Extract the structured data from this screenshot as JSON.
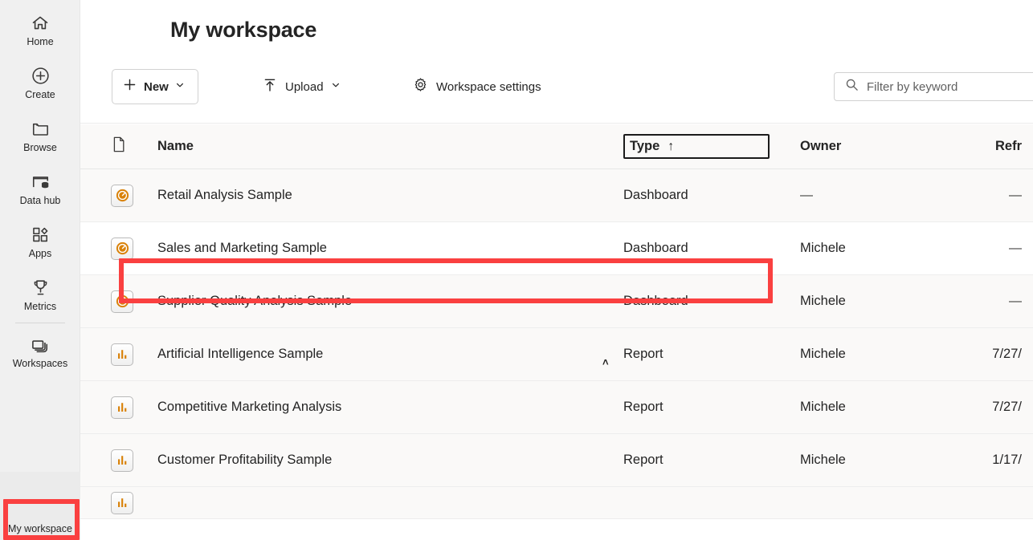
{
  "sidebar": {
    "items": [
      {
        "label": "Home",
        "icon": "home-icon"
      },
      {
        "label": "Create",
        "icon": "plus-circle-icon"
      },
      {
        "label": "Browse",
        "icon": "folder-icon"
      },
      {
        "label": "Data hub",
        "icon": "data-hub-icon"
      },
      {
        "label": "Apps",
        "icon": "apps-icon"
      },
      {
        "label": "Metrics",
        "icon": "trophy-icon"
      },
      {
        "label": "Workspaces",
        "icon": "workspaces-icon"
      }
    ],
    "active_workspace": {
      "label": "My workspace",
      "accent_color": "#0f6e64"
    }
  },
  "header": {
    "title": "My workspace"
  },
  "toolbar": {
    "new_label": "New",
    "new_icon": "plus-icon",
    "new_chevron": "chevron-down-icon",
    "upload_label": "Upload",
    "upload_icon": "upload-arrow-icon",
    "upload_chevron": "chevron-down-icon",
    "settings_label": "Workspace settings",
    "settings_icon": "gear-icon"
  },
  "search": {
    "placeholder": "Filter by keyword",
    "value": "",
    "icon": "search-icon"
  },
  "table": {
    "columns": {
      "icon": "document-icon",
      "name": "Name",
      "type": "Type",
      "owner": "Owner",
      "refreshed": "Refr"
    },
    "sort": {
      "column": "Type",
      "direction": "ascending",
      "arrow": "↑",
      "focused": true
    },
    "rows": [
      {
        "icon": "dashboard-icon",
        "name": "Retail Analysis Sample",
        "type": "Dashboard",
        "owner": "—",
        "refreshed": "—",
        "highlighted": false
      },
      {
        "icon": "dashboard-icon",
        "name": "Sales and Marketing Sample",
        "type": "Dashboard",
        "owner": "Michele",
        "refreshed": "—",
        "highlighted": true
      },
      {
        "icon": "dashboard-icon",
        "name": "Supplier Quality Analysis Sample",
        "type": "Dashboard",
        "owner": "Michele",
        "refreshed": "—",
        "highlighted": false
      },
      {
        "icon": "report-icon",
        "name": "Artificial Intelligence Sample",
        "type": "Report",
        "owner": "Michele",
        "refreshed": "7/27/",
        "highlighted": false
      },
      {
        "icon": "report-icon",
        "name": "Competitive Marketing Analysis",
        "type": "Report",
        "owner": "Michele",
        "refreshed": "7/27/",
        "highlighted": false
      },
      {
        "icon": "report-icon",
        "name": "Customer Profitability Sample",
        "type": "Report",
        "owner": "Michele",
        "refreshed": "1/17/",
        "highlighted": false
      }
    ],
    "caret_marker": "˄"
  },
  "annotations": {
    "color": "#fa4040",
    "row_target": "Sales and Marketing Sample",
    "sidebar_target": "My workspace"
  }
}
